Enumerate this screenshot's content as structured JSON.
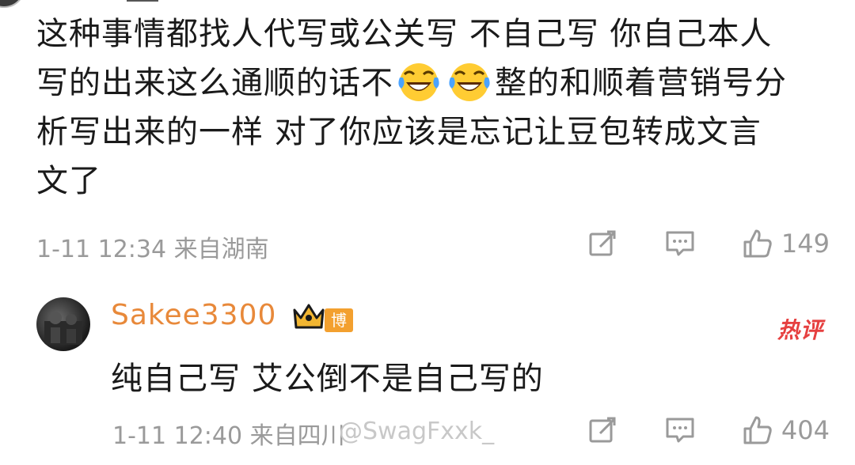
{
  "comment": {
    "line1": "这种事情都找人代写或公关写 不自己写 你自己本人",
    "line2_before": "写的出来这么通顺的话不",
    "line2_after": "整的和顺着营销号分",
    "line3": "析写出来的一样 对了你应该是忘记让豆包转成文言",
    "line4": "文了",
    "emoji_icon": "laughing-tears-emoji",
    "time": "1-11 12:34",
    "location": "来自湖南",
    "likes": "149"
  },
  "reply": {
    "username": "Sakee3300",
    "badge": "博主",
    "hot_label": "热评",
    "text": "纯自己写 艾公倒不是自己写的",
    "time": "1-11 12:40",
    "location": "来自四川",
    "likes": "404"
  },
  "watermark": "@SwagFxxk_",
  "colors": {
    "username": "#e8893a",
    "badge": "#f3a02f",
    "hot": "#e64040",
    "meta": "#9a9a9a"
  },
  "icons": [
    "share-icon",
    "comment-icon",
    "like-icon",
    "crown-icon"
  ]
}
